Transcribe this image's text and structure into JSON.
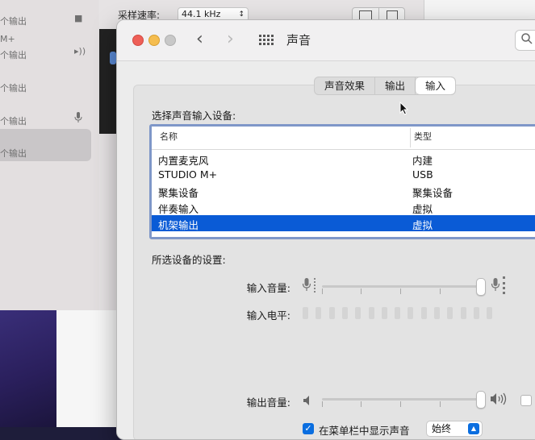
{
  "background_window": {
    "sidebar_items": [
      {
        "label": "个输出",
        "icon": "chat-bubble-icon"
      },
      {
        "label": "M+",
        "icon": ""
      },
      {
        "label": "个输出",
        "icon": "speaker-icon"
      },
      {
        "label": "个输出",
        "icon": ""
      },
      {
        "label": "个输出",
        "icon": "microphone-icon"
      },
      {
        "label": "个输出",
        "icon": ""
      }
    ],
    "sample_rate_label": "采样速率:",
    "sample_rate_value": "44.1 kHz"
  },
  "window": {
    "title": "声音",
    "search_placeholder": ""
  },
  "tabs": [
    {
      "label": "声音效果",
      "active": false
    },
    {
      "label": "输出",
      "active": false
    },
    {
      "label": "输入",
      "active": true
    }
  ],
  "input_section": {
    "title": "选择声音输入设备:",
    "columns": {
      "name": "名称",
      "type": "类型"
    },
    "devices": [
      {
        "name": "内置麦克风",
        "type": "内建",
        "selected": false
      },
      {
        "name": "STUDIO M+",
        "type": "USB",
        "selected": false
      },
      {
        "name": "聚集设备",
        "type": "聚集设备",
        "selected": false
      },
      {
        "name": "伴奏输入",
        "type": "虚拟",
        "selected": false
      },
      {
        "name": "机架输出",
        "type": "虚拟",
        "selected": true
      }
    ]
  },
  "settings": {
    "title": "所选设备的设置:",
    "input_volume_label": "输入音量:",
    "input_volume_level": 1.0,
    "input_level_label": "输入电平:",
    "input_level_segments": 15
  },
  "output": {
    "volume_label": "输出音量:",
    "volume_level": 1.0,
    "show_in_menubar_label": "在菜单栏中显示声音",
    "show_in_menubar_checked": true,
    "show_option": "始终"
  }
}
